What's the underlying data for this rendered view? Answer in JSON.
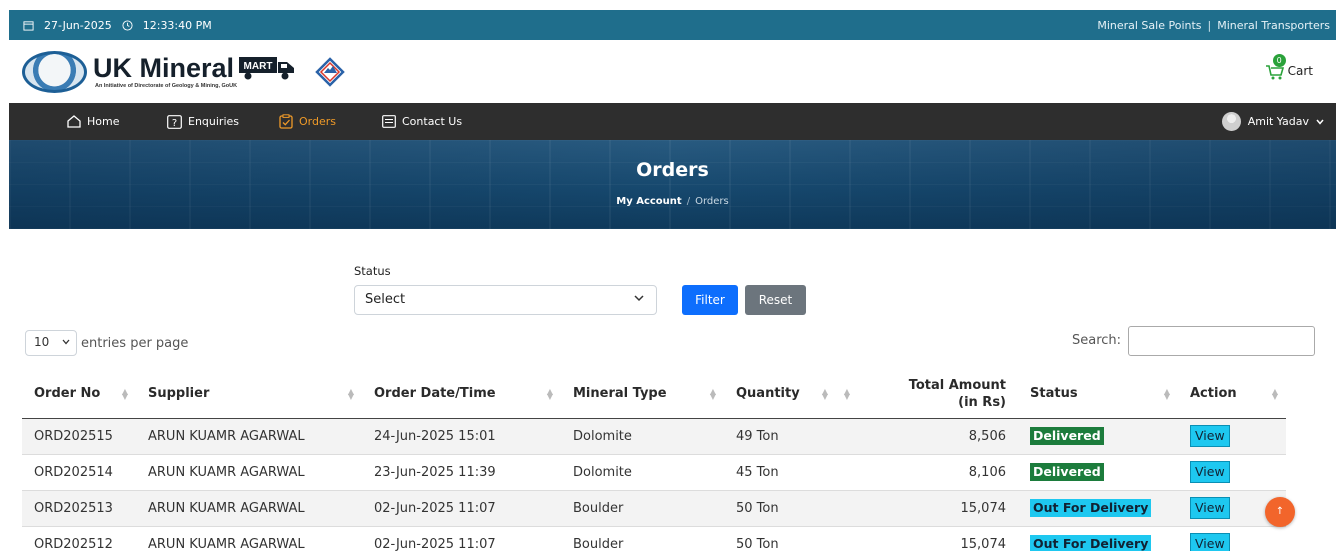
{
  "topbar": {
    "date": "27-Jun-2025",
    "time": "12:33:40 PM",
    "links": [
      "Mineral Sale Points",
      "Mineral Transporters"
    ]
  },
  "brand": {
    "title": "UK Mineral",
    "truck_word": "MART",
    "subtitle": "An Initiative of Directorate of Geology & Mining, GoUK"
  },
  "cart": {
    "label": "Cart",
    "count": "0"
  },
  "nav": {
    "items": [
      {
        "label": "Home",
        "icon": "home-icon"
      },
      {
        "label": "Enquiries",
        "icon": "question-box-icon"
      },
      {
        "label": "Orders",
        "icon": "clipboard-check-icon",
        "active": true
      },
      {
        "label": "Contact Us",
        "icon": "message-icon"
      }
    ],
    "user": "Amit Yadav"
  },
  "hero": {
    "title": "Orders",
    "breadcrumb": {
      "home": "My Account",
      "current": "Orders"
    }
  },
  "filter": {
    "status_label": "Status",
    "status_value": "Select",
    "filter_button": "Filter",
    "reset_button": "Reset"
  },
  "table_controls": {
    "entries_value": "10",
    "entries_label": "entries per page",
    "search_label": "Search:"
  },
  "table": {
    "headers": [
      "Order No",
      "Supplier",
      "Order Date/Time",
      "Mineral Type",
      "Quantity",
      "Total Amount (in Rs)",
      "Status",
      "Action"
    ],
    "header_amount_line1": "Total Amount",
    "header_amount_line2": "(in Rs)",
    "rows": [
      {
        "order_no": "ORD202515",
        "supplier": "ARUN KUAMR AGARWAL",
        "datetime": "24-Jun-2025 15:01",
        "mineral": "Dolomite",
        "quantity": "49 Ton",
        "amount": "8,506",
        "status": "Delivered",
        "action": "View"
      },
      {
        "order_no": "ORD202514",
        "supplier": "ARUN KUAMR AGARWAL",
        "datetime": "23-Jun-2025 11:39",
        "mineral": "Dolomite",
        "quantity": "45 Ton",
        "amount": "8,106",
        "status": "Delivered",
        "action": "View"
      },
      {
        "order_no": "ORD202513",
        "supplier": "ARUN KUAMR AGARWAL",
        "datetime": "02-Jun-2025 11:07",
        "mineral": "Boulder",
        "quantity": "50 Ton",
        "amount": "15,074",
        "status": "Out For Delivery",
        "action": "View"
      },
      {
        "order_no": "ORD202512",
        "supplier": "ARUN KUAMR AGARWAL",
        "datetime": "02-Jun-2025 11:07",
        "mineral": "Boulder",
        "quantity": "50 Ton",
        "amount": "15,074",
        "status": "Out For Delivery",
        "action": "View"
      }
    ]
  },
  "colors": {
    "topbar": "#1f6e8c",
    "nav": "#2e2e2e",
    "nav_active": "#ef9a28",
    "delivered": "#1c7c3c",
    "out_for_delivery": "#1ec8f0",
    "filter_button": "#0d6efd",
    "reset_button": "#6c757d",
    "scroll_top": "#f2652b"
  }
}
